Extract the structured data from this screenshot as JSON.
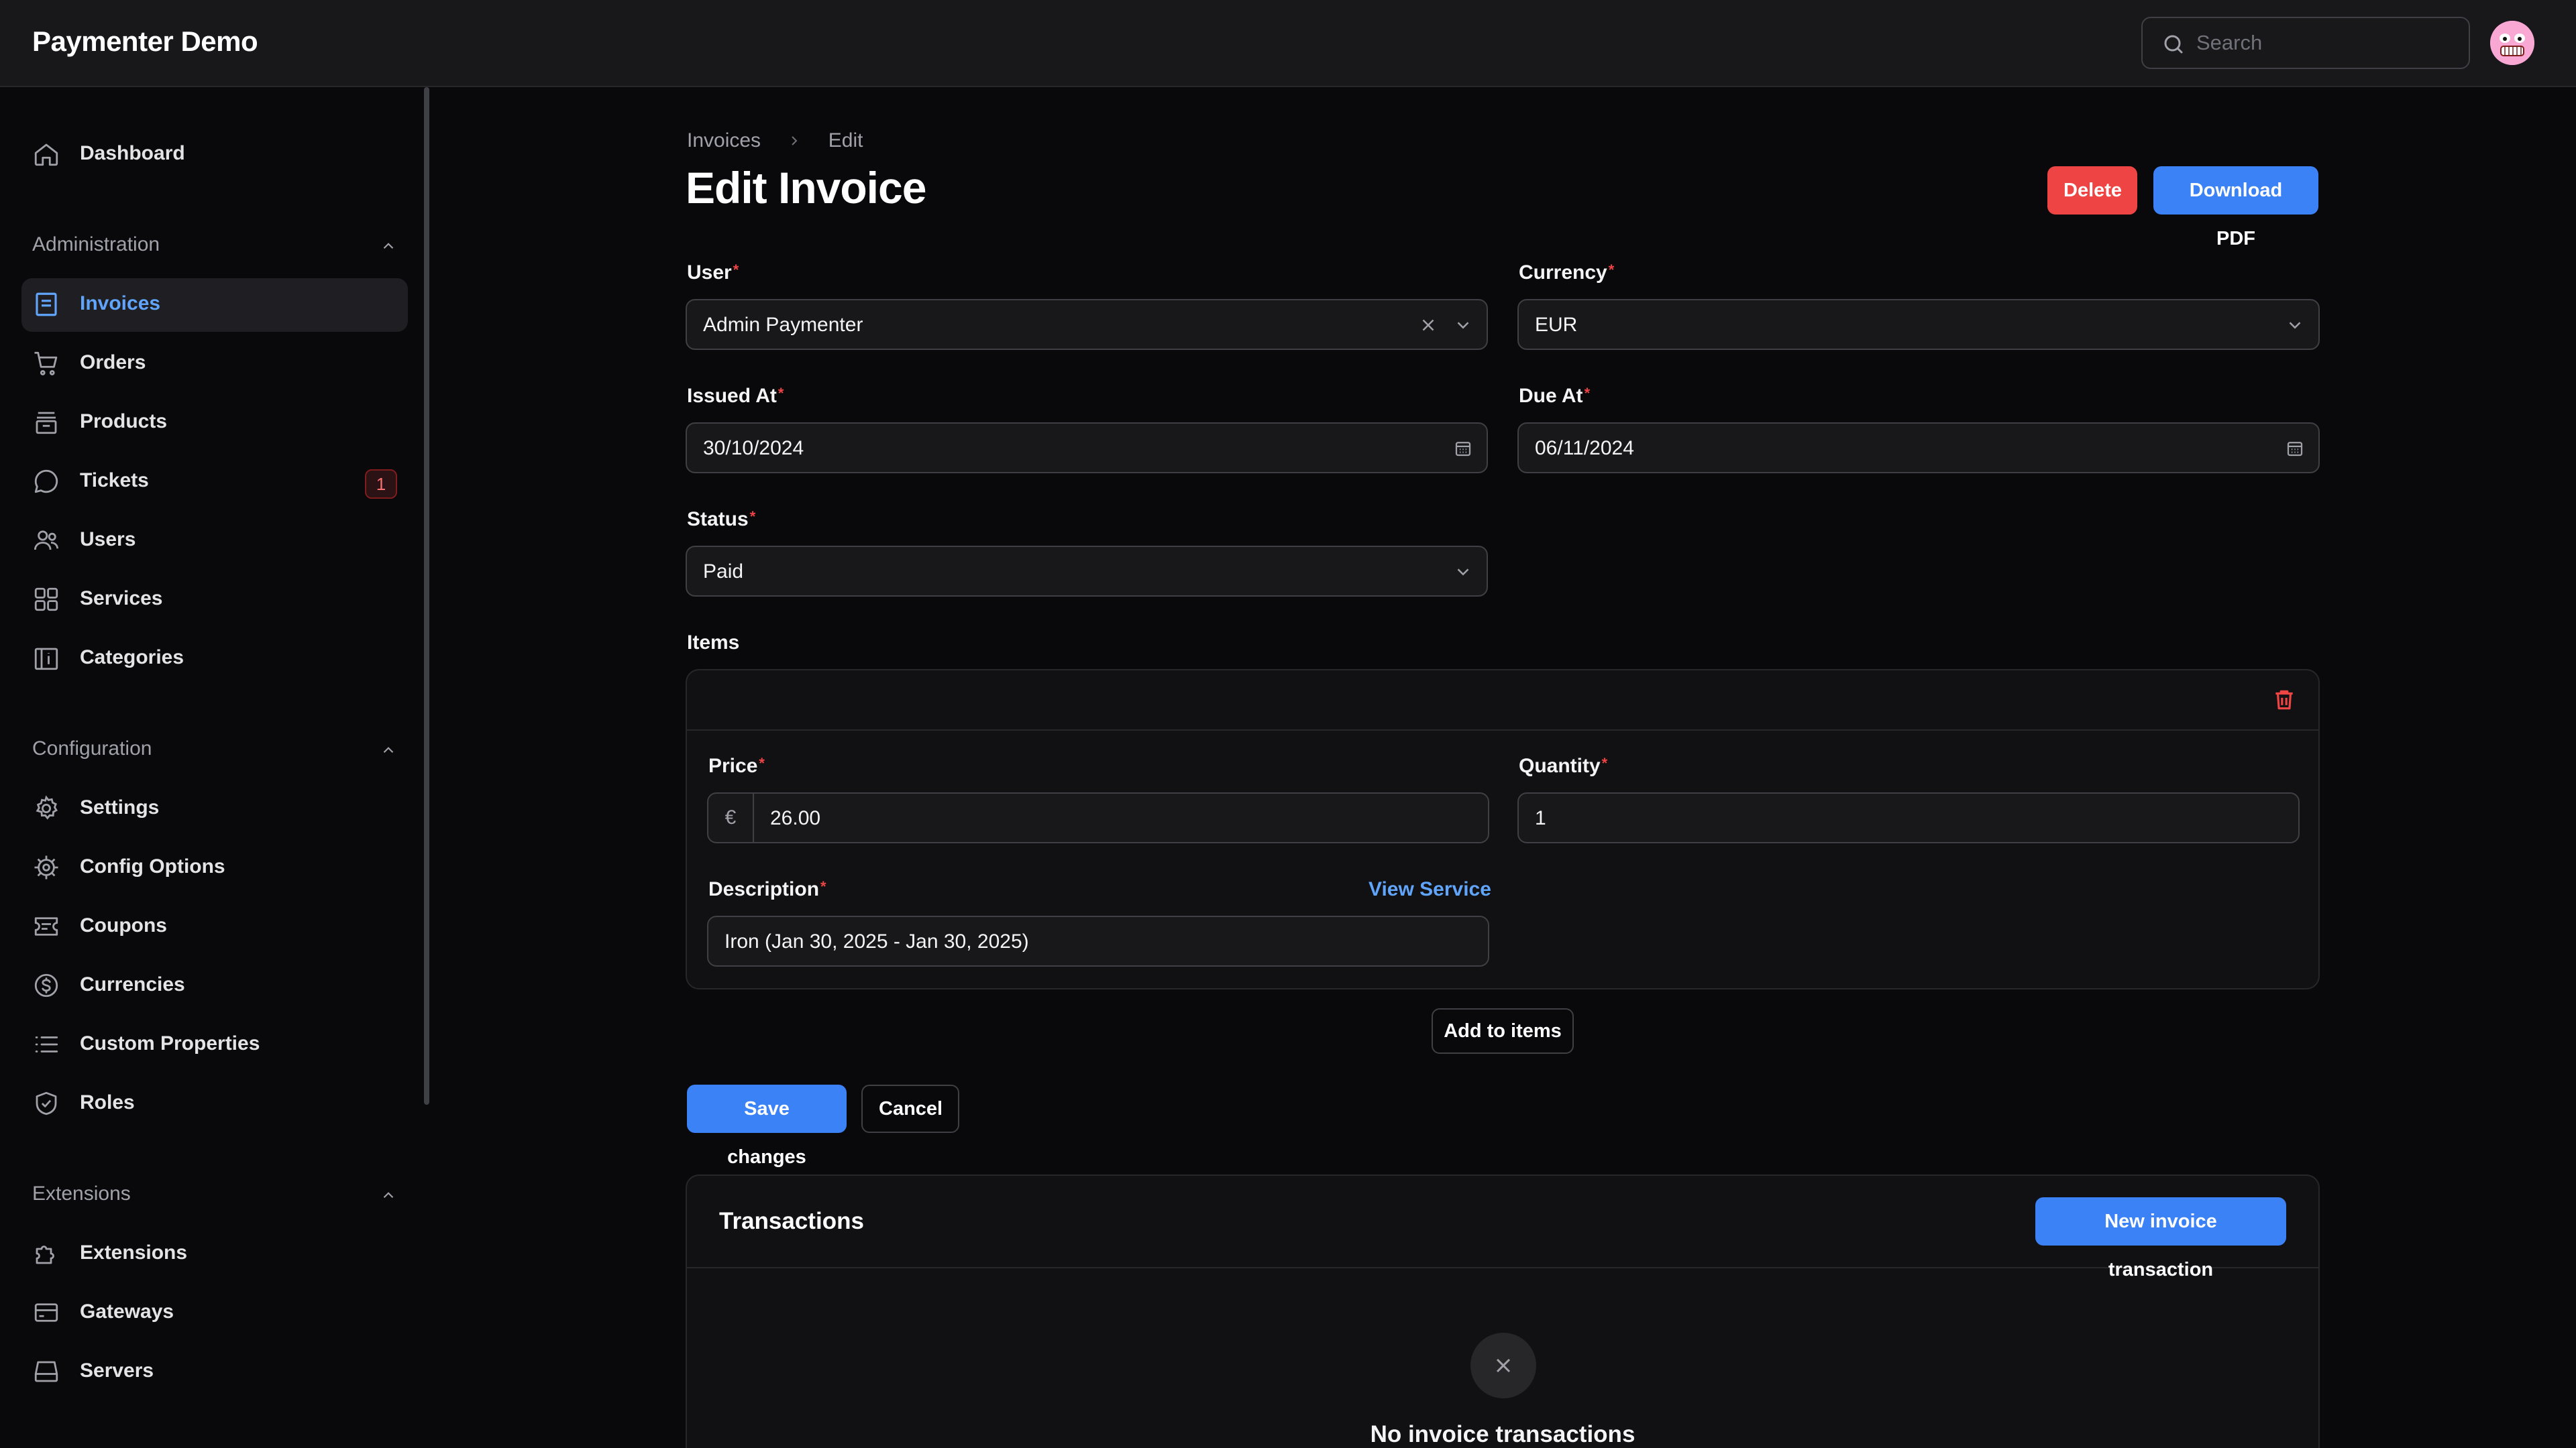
{
  "app": {
    "name": "Paymenter Demo"
  },
  "search": {
    "placeholder": "Search"
  },
  "sidebar": {
    "dashboard": "Dashboard",
    "groups": {
      "administration": "Administration",
      "configuration": "Configuration",
      "extensions": "Extensions"
    },
    "items": {
      "invoices": "Invoices",
      "orders": "Orders",
      "products": "Products",
      "tickets": "Tickets",
      "tickets_badge": "1",
      "users": "Users",
      "services": "Services",
      "categories": "Categories",
      "settings": "Settings",
      "config_options": "Config Options",
      "coupons": "Coupons",
      "currencies": "Currencies",
      "custom_properties": "Custom Properties",
      "roles": "Roles",
      "extensions": "Extensions",
      "gateways": "Gateways",
      "servers": "Servers"
    }
  },
  "breadcrumb": {
    "parent": "Invoices",
    "current": "Edit"
  },
  "page": {
    "title": "Edit Invoice",
    "delete": "Delete",
    "download_pdf": "Download PDF"
  },
  "form": {
    "user": {
      "label": "User",
      "value": "Admin Paymenter"
    },
    "currency": {
      "label": "Currency",
      "value": "EUR"
    },
    "issued_at": {
      "label": "Issued At",
      "value": "30/10/2024"
    },
    "due_at": {
      "label": "Due At",
      "value": "06/11/2024"
    },
    "status": {
      "label": "Status",
      "value": "Paid"
    },
    "items_label": "Items",
    "item": {
      "price_label": "Price",
      "currency_symbol": "€",
      "price": "26.00",
      "quantity_label": "Quantity",
      "quantity": "1",
      "description_label": "Description",
      "view_service": "View Service",
      "description": "Iron (Jan 30, 2025 - Jan 30, 2025)"
    },
    "add_to_items": "Add to items",
    "save": "Save changes",
    "cancel": "Cancel"
  },
  "transactions": {
    "title": "Transactions",
    "new_button": "New invoice transaction",
    "empty": "No invoice transactions"
  },
  "colors": {
    "accent": "#3b82f6",
    "danger": "#ef4444",
    "background": "#09090b"
  }
}
